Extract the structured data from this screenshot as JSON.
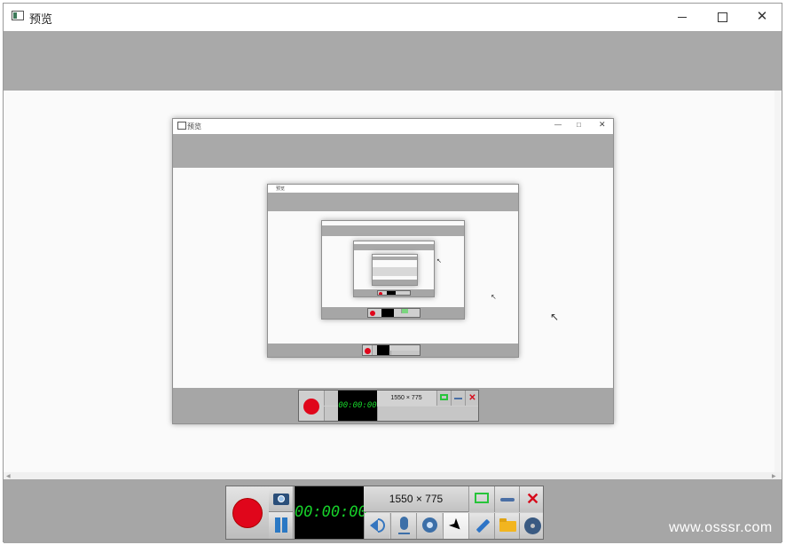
{
  "window": {
    "title": "预览",
    "controls": {
      "minimize": "minimize-icon",
      "maximize": "maximize-icon",
      "close": "close-icon"
    }
  },
  "toolbar": {
    "record_icon": "record-icon",
    "snapshot_icon": "camera-icon",
    "pause_icon": "pause-icon",
    "timer": "00:00:00",
    "dimensions": "1550 × 775",
    "region_icon": "rectangle-region-icon",
    "minimize_icon": "minimize-toolbar-icon",
    "close_icon": "close-icon",
    "tools": [
      "speaker-icon",
      "microphone-icon",
      "webcam-icon",
      "cursor-icon",
      "pen-icon",
      "folder-icon",
      "settings-gear-icon"
    ]
  },
  "colors": {
    "record": "#e0061b",
    "timer_text": "#17d12a",
    "region_green": "#27c43a",
    "close_red": "#d60b1b"
  },
  "nested_preview": {
    "level1": {
      "title": "预览",
      "dimensions": "1550 × 775",
      "timer": "00:00:00"
    },
    "level2": {
      "title": "预览",
      "timer": "00:00:00"
    }
  },
  "watermark": "www.osssr.com"
}
